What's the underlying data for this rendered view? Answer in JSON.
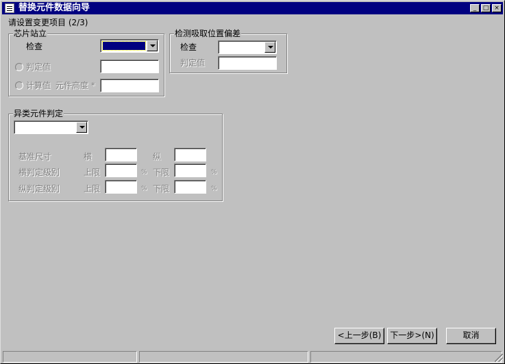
{
  "window": {
    "title": "替换元件数据向导",
    "controls": [
      "_",
      "□",
      "×"
    ]
  },
  "instruction": "请设置变更项目 (2/3)",
  "chip_standing": {
    "group_label": "芯片站立",
    "check_label": "检查",
    "judge_value_label": "判定值",
    "calc_value_label": "计算值",
    "part_height_label": "元件高度 *"
  },
  "pickup_offset": {
    "group_label": "检测吸取位置偏差",
    "check_label": "检查",
    "judge_value_label": "判定值"
  },
  "odd_part": {
    "group_label": "异类元件判定",
    "base_size_label": "基准尺寸",
    "horizontal_label": "横",
    "vertical_label": "纵",
    "h_judge_label": "横判定级别",
    "v_judge_label": "纵判定级别",
    "upper_label": "上限",
    "lower_label": "下限",
    "percent": "%"
  },
  "buttons": {
    "prev": "<上一步(B)",
    "next": "下一步>(N)",
    "cancel": "取消"
  }
}
